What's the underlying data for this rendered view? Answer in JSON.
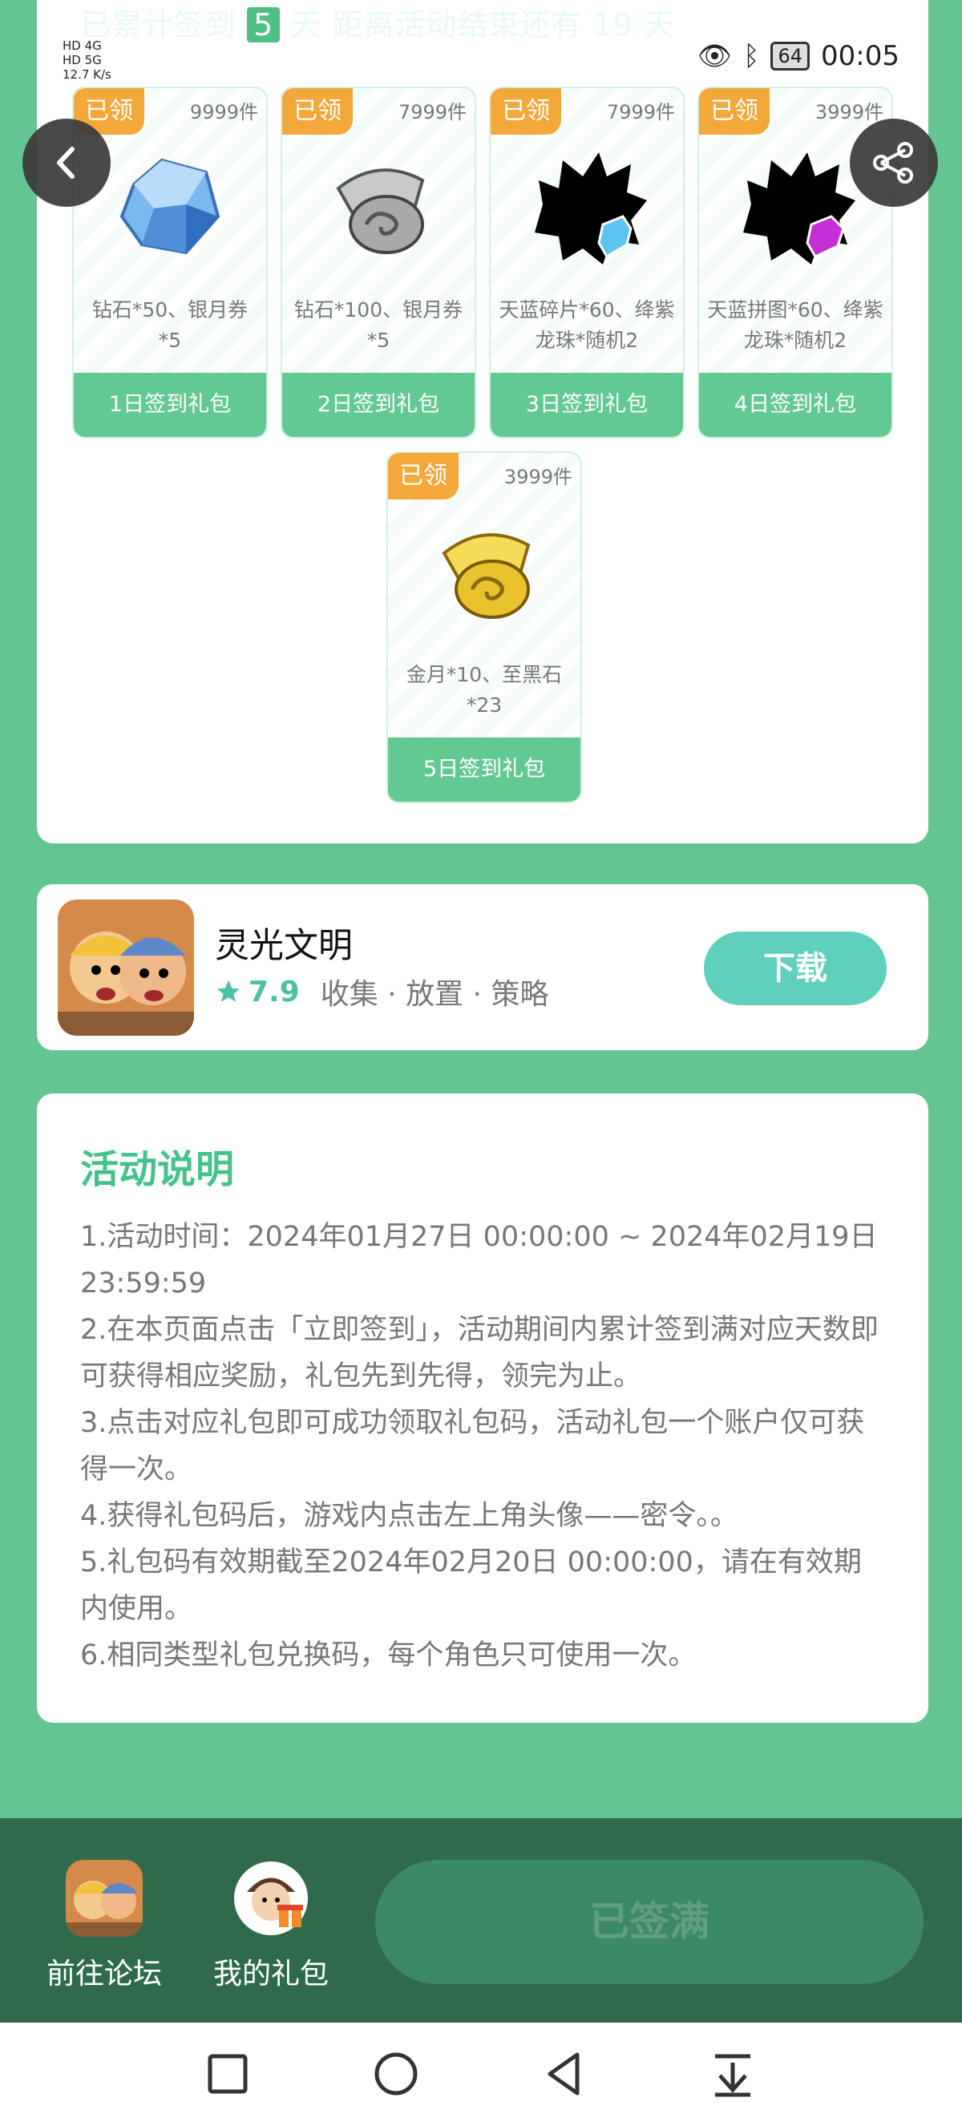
{
  "signin_strip": {
    "prefix": "已累计签到",
    "days": "5",
    "suffix": "天  距离活动结束还有 19 天"
  },
  "statusbar": {
    "left_lines": [
      "HD 4G",
      "HD 5G",
      "12.7 K/s"
    ],
    "battery": "64",
    "time": "00:05"
  },
  "gifts": [
    {
      "tag": "已领",
      "stock": "9999件",
      "desc": "钻石*50、银月券*5",
      "title": "1日签到礼包",
      "art": "diamond-icon"
    },
    {
      "tag": "已领",
      "stock": "7999件",
      "desc": "钻石*100、银月券*5",
      "title": "2日签到礼包",
      "art": "silver-scroll-icon"
    },
    {
      "tag": "已领",
      "stock": "7999件",
      "desc": "天蓝碎片*60、绛紫龙珠*随机2",
      "title": "3日签到礼包",
      "art": "blue-puzzle-avatar-icon"
    },
    {
      "tag": "已领",
      "stock": "3999件",
      "desc": "天蓝拼图*60、绛紫龙珠*随机2",
      "title": "4日签到礼包",
      "art": "purple-puzzle-avatar-icon"
    },
    {
      "tag": "已领",
      "stock": "3999件",
      "desc": "金月*10、至黑石*23",
      "title": "5日签到礼包",
      "art": "gold-scroll-icon"
    }
  ],
  "app": {
    "name": "灵光文明",
    "rating": "7.9",
    "tags": "收集 · 放置 · 策略",
    "download_label": "下载"
  },
  "rules": {
    "title": "活动说明",
    "lines": [
      "1.活动时间：2024年01月27日 00:00:00 ~ 2024年02月19日 23:59:59",
      "2.在本页面点击「立即签到」，活动期间内累计签到满对应天数即可获得相应奖励，礼包先到先得，领完为止。",
      "3.点击对应礼包即可成功领取礼包码，活动礼包一个账户仅可获得一次。",
      "4.获得礼包码后，游戏内点击左上角头像——密令。。",
      "5.礼包码有效期截至2024年02月20日 00:00:00，请在有效期内使用。",
      "6.相同类型礼包兑换码，每个角色只可使用一次。"
    ]
  },
  "bottom": {
    "forum_label": "前往论坛",
    "gifts_label": "我的礼包",
    "signed_label": "已签满"
  },
  "colors": {
    "page_bg": "#64c592",
    "accent": "#45c28a",
    "tag": "#f5a83a",
    "download": "#5ed0bd"
  }
}
